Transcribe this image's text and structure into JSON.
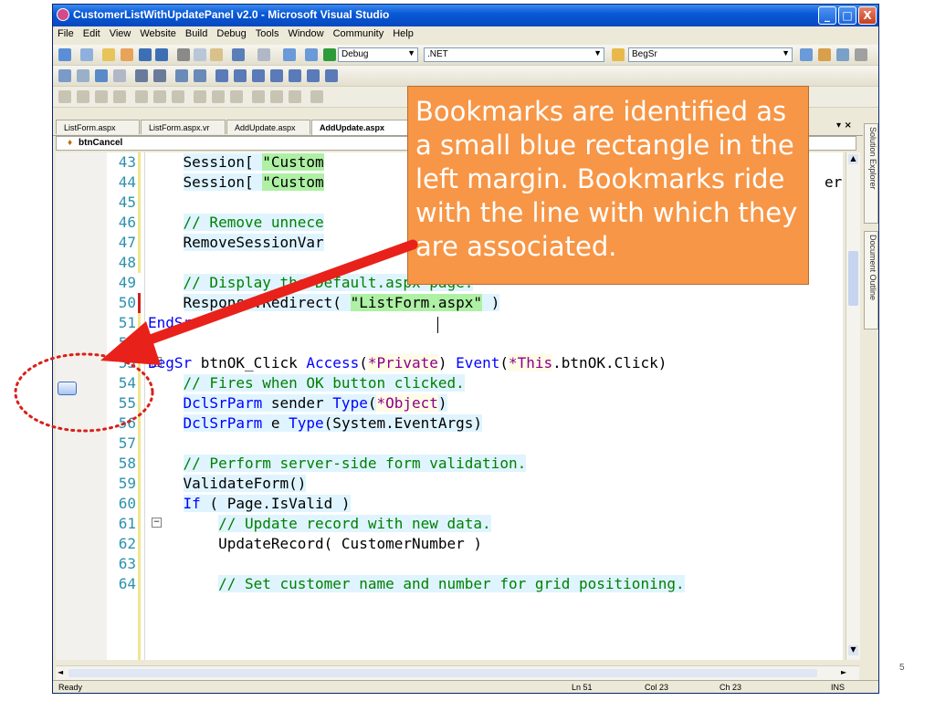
{
  "window": {
    "title": "CustomerListWithUpdatePanel v2.0 - Microsoft Visual Studio",
    "controls": {
      "minimize": "_",
      "maximize": "□",
      "close": "X"
    }
  },
  "menu": [
    "File",
    "Edit",
    "View",
    "Website",
    "Build",
    "Debug",
    "Tools",
    "Window",
    "Community",
    "Help"
  ],
  "toolbar": {
    "configuration": "Debug",
    "platform": ".NET",
    "find": "BegSr"
  },
  "tabs": [
    {
      "label": "ListForm.aspx"
    },
    {
      "label": "ListForm.aspx.vr"
    },
    {
      "label": "AddUpdate.aspx"
    },
    {
      "label": "AddUpdate.aspx"
    }
  ],
  "navbar": {
    "member": "btnCancel"
  },
  "side_panels": [
    "Solution Explorer",
    "Document Outline"
  ],
  "code_lines": [
    {
      "n": "43",
      "text": "        Session[ \"Custom"
    },
    {
      "n": "44",
      "text": "        Session[ \"Custom"
    },
    {
      "n": "45",
      "text": ""
    },
    {
      "n": "46",
      "text": "        // Remove unnece"
    },
    {
      "n": "47",
      "text": "        RemoveSessionVar"
    },
    {
      "n": "48",
      "text": ""
    },
    {
      "n": "49",
      "text": "        // Display the Default.aspx page."
    },
    {
      "n": "50",
      "text": "        Response.Redirect( \"ListForm.aspx\" )"
    },
    {
      "n": "51",
      "text": "    EndSr"
    },
    {
      "n": "52",
      "text": ""
    },
    {
      "n": "53",
      "text": "    BegSr btnOK_Click Access(*Private) Event(*This.btnOK.Click)"
    },
    {
      "n": "54",
      "text": "        // Fires when OK button clicked."
    },
    {
      "n": "55",
      "text": "        DclSrParm sender Type(*Object)"
    },
    {
      "n": "56",
      "text": "        DclSrParm e Type(System.EventArgs)"
    },
    {
      "n": "57",
      "text": ""
    },
    {
      "n": "58",
      "text": "        // Perform server-side form validation."
    },
    {
      "n": "59",
      "text": "        ValidateForm()"
    },
    {
      "n": "60",
      "text": "        If ( Page.IsValid )"
    },
    {
      "n": "61",
      "text": "            // Update record with new data."
    },
    {
      "n": "62",
      "text": "            UpdateRecord( CustomerNumber )"
    },
    {
      "n": "63",
      "text": ""
    },
    {
      "n": "64",
      "text": "            // Set customer name and number for grid positioning."
    }
  ],
  "code_tail_44": "er",
  "status": {
    "ready": "Ready",
    "ln": "Ln 51",
    "col": "Col 23",
    "ch": "Ch 23",
    "mode": "INS"
  },
  "callout": "Bookmarks are identified as a small blue rectangle in the left margin. Bookmarks ride with the line with which they are associated.",
  "slide_number": "5",
  "colors": {
    "callout": "#f79646",
    "arrow": "#e8211b",
    "bookmark": "#a9c4ee",
    "titlebar": "#0a5ad6"
  }
}
